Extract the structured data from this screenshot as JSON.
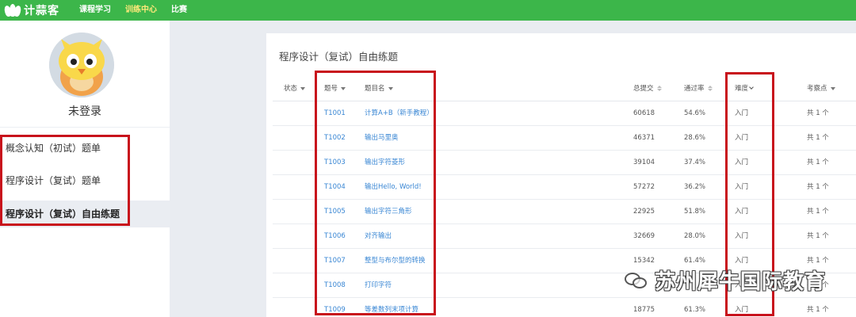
{
  "topbar": {
    "logo_text": "计蒜客",
    "nav": [
      "课程学习",
      "训练中心",
      "比赛"
    ],
    "active_nav_index": 1
  },
  "sidebar": {
    "user_name": "未登录",
    "menu": [
      "概念认知（初试）题单",
      "程序设计（复试）题单",
      "程序设计（复试）自由练题"
    ],
    "active_menu_index": 2
  },
  "main": {
    "title": "程序设计（复试）自由练题",
    "columns": {
      "status": "状态",
      "id": "题号",
      "name": "题目名",
      "submissions": "总提交",
      "pass_rate": "通过率",
      "difficulty": "难度",
      "points": "考察点"
    },
    "rows": [
      {
        "id": "T1001",
        "name": "计算A+B（新手教程）",
        "submissions": "60618",
        "pass_rate": "54.6%",
        "difficulty": "入门",
        "points": "共 1 个"
      },
      {
        "id": "T1002",
        "name": "输出马里奥",
        "submissions": "46371",
        "pass_rate": "28.6%",
        "difficulty": "入门",
        "points": "共 1 个"
      },
      {
        "id": "T1003",
        "name": "输出字符菱形",
        "submissions": "39104",
        "pass_rate": "37.4%",
        "difficulty": "入门",
        "points": "共 1 个"
      },
      {
        "id": "T1004",
        "name": "输出Hello, World!",
        "submissions": "57272",
        "pass_rate": "36.2%",
        "difficulty": "入门",
        "points": "共 1 个"
      },
      {
        "id": "T1005",
        "name": "输出字符三角形",
        "submissions": "22925",
        "pass_rate": "51.8%",
        "difficulty": "入门",
        "points": "共 1 个"
      },
      {
        "id": "T1006",
        "name": "对齐输出",
        "submissions": "32669",
        "pass_rate": "28.0%",
        "difficulty": "入门",
        "points": "共 1 个"
      },
      {
        "id": "T1007",
        "name": "整型与布尔型的转换",
        "submissions": "15342",
        "pass_rate": "61.4%",
        "difficulty": "入门",
        "points": "共 1 个"
      },
      {
        "id": "T1008",
        "name": "打印字符",
        "submissions": "",
        "pass_rate": "",
        "difficulty": "入门",
        "points": "共 1 个"
      },
      {
        "id": "T1009",
        "name": "等差数列末项计算",
        "submissions": "18775",
        "pass_rate": "61.3%",
        "difficulty": "入门",
        "points": "共 1 个"
      }
    ]
  },
  "watermark": {
    "icon": "wechat-icon",
    "text": "苏州犀牛国际教育"
  },
  "colors": {
    "brand_green": "#3cb64a",
    "active_nav": "#ffe97a",
    "link_blue": "#3a87d4",
    "highlight_red": "#c8121c"
  }
}
